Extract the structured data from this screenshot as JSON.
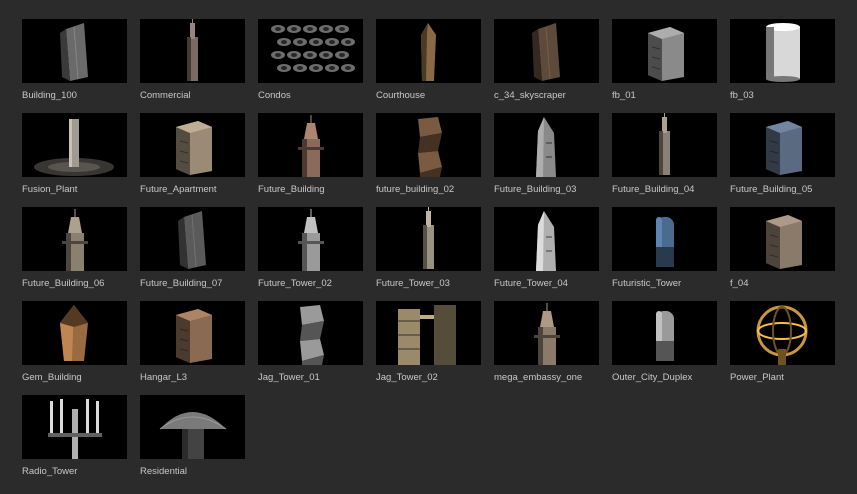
{
  "assets": [
    {
      "label": "Building_100",
      "icon": "building-thumbnail-icon",
      "kind": "slab",
      "tint": "#6a6a6a"
    },
    {
      "label": "Commercial",
      "icon": "building-thumbnail-icon",
      "kind": "spire",
      "tint": "#7a6a62"
    },
    {
      "label": "Condos",
      "icon": "building-thumbnail-icon",
      "kind": "cluster",
      "tint": "#6d6d6d"
    },
    {
      "label": "Courthouse",
      "icon": "building-thumbnail-icon",
      "kind": "obelisk",
      "tint": "#8a6a44"
    },
    {
      "label": "c_34_skyscraper",
      "icon": "building-thumbnail-icon",
      "kind": "slab",
      "tint": "#5e4a3a"
    },
    {
      "label": "fb_01",
      "icon": "building-thumbnail-icon",
      "kind": "block",
      "tint": "#8a8a8a"
    },
    {
      "label": "fb_03",
      "icon": "building-thumbnail-icon",
      "kind": "cylinder",
      "tint": "#d8d8d8"
    },
    {
      "label": "Fusion_Plant",
      "icon": "building-thumbnail-icon",
      "kind": "plant",
      "tint": "#a09a90"
    },
    {
      "label": "Future_Apartment",
      "icon": "building-thumbnail-icon",
      "kind": "block",
      "tint": "#9a8a76"
    },
    {
      "label": "Future_Building",
      "icon": "building-thumbnail-icon",
      "kind": "tower",
      "tint": "#8a6a5a"
    },
    {
      "label": "future_building_02",
      "icon": "building-thumbnail-icon",
      "kind": "twisted",
      "tint": "#7a5a40"
    },
    {
      "label": "Future_Building_03",
      "icon": "building-thumbnail-icon",
      "kind": "shard",
      "tint": "#8a8a8a"
    },
    {
      "label": "Future_Building_04",
      "icon": "building-thumbnail-icon",
      "kind": "spire",
      "tint": "#8a8074"
    },
    {
      "label": "Future_Building_05",
      "icon": "building-thumbnail-icon",
      "kind": "block",
      "tint": "#5a6a80"
    },
    {
      "label": "Future_Building_06",
      "icon": "building-thumbnail-icon",
      "kind": "tower",
      "tint": "#8a8070"
    },
    {
      "label": "Future_Building_07",
      "icon": "building-thumbnail-icon",
      "kind": "slab",
      "tint": "#5a5a5a"
    },
    {
      "label": "Future_Tower_02",
      "icon": "building-thumbnail-icon",
      "kind": "tower",
      "tint": "#9a9a9a"
    },
    {
      "label": "Future_Tower_03",
      "icon": "building-thumbnail-icon",
      "kind": "spire",
      "tint": "#9a9080"
    },
    {
      "label": "Future_Tower_04",
      "icon": "building-thumbnail-icon",
      "kind": "shard",
      "tint": "#b0b0b0"
    },
    {
      "label": "Futuristic_Tower",
      "icon": "building-thumbnail-icon",
      "kind": "capsule",
      "tint": "#4a6a90"
    },
    {
      "label": "f_04",
      "icon": "building-thumbnail-icon",
      "kind": "block",
      "tint": "#8a7a6a"
    },
    {
      "label": "Gem_Building",
      "icon": "building-thumbnail-icon",
      "kind": "gem",
      "tint": "#9a6a40"
    },
    {
      "label": "Hangar_L3",
      "icon": "building-thumbnail-icon",
      "kind": "block",
      "tint": "#8a6a50"
    },
    {
      "label": "Jag_Tower_01",
      "icon": "building-thumbnail-icon",
      "kind": "twisted",
      "tint": "#9a9a9a"
    },
    {
      "label": "Jag_Tower_02",
      "icon": "building-thumbnail-icon",
      "kind": "twin",
      "tint": "#9a8a6a"
    },
    {
      "label": "mega_embassy_one",
      "icon": "building-thumbnail-icon",
      "kind": "tower",
      "tint": "#8a7a6a"
    },
    {
      "label": "Outer_City_Duplex",
      "icon": "building-thumbnail-icon",
      "kind": "capsule",
      "tint": "#9a9a9a"
    },
    {
      "label": "Power_Plant",
      "icon": "building-thumbnail-icon",
      "kind": "sphere",
      "tint": "#c8963c"
    },
    {
      "label": "Radio_Tower",
      "icon": "building-thumbnail-icon",
      "kind": "antenna",
      "tint": "#b0b0b0"
    },
    {
      "label": "Residential",
      "icon": "building-thumbnail-icon",
      "kind": "dome",
      "tint": "#7a7a7a"
    }
  ]
}
